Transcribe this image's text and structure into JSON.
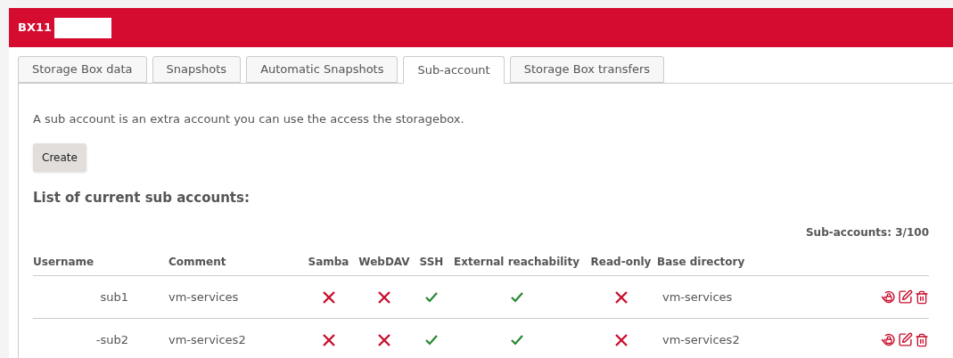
{
  "header": {
    "title": "BX11"
  },
  "tabs": [
    {
      "label": "Storage Box data",
      "selected": false
    },
    {
      "label": "Snapshots",
      "selected": false
    },
    {
      "label": "Automatic Snapshots",
      "selected": false
    },
    {
      "label": "Sub-account",
      "selected": true
    },
    {
      "label": "Storage Box transfers",
      "selected": false
    }
  ],
  "description": "A sub account is an extra account you can use the access the storagebox.",
  "create_button": "Create",
  "list_heading": "List of current sub accounts:",
  "count": "Sub-accounts: 3/100",
  "table": {
    "columns": [
      "Username",
      "Comment",
      "Samba",
      "WebDAV",
      "SSH",
      "External reachability",
      "Read-only",
      "Base directory"
    ],
    "rows": [
      {
        "username": "sub1",
        "comment": "vm-services",
        "samba": false,
        "webdav": false,
        "ssh": true,
        "external": true,
        "readonly": false,
        "base_directory": "vm-services"
      },
      {
        "username": "-sub2",
        "comment": "vm-services2",
        "samba": false,
        "webdav": false,
        "ssh": true,
        "external": true,
        "readonly": false,
        "base_directory": "vm-services2"
      }
    ]
  }
}
